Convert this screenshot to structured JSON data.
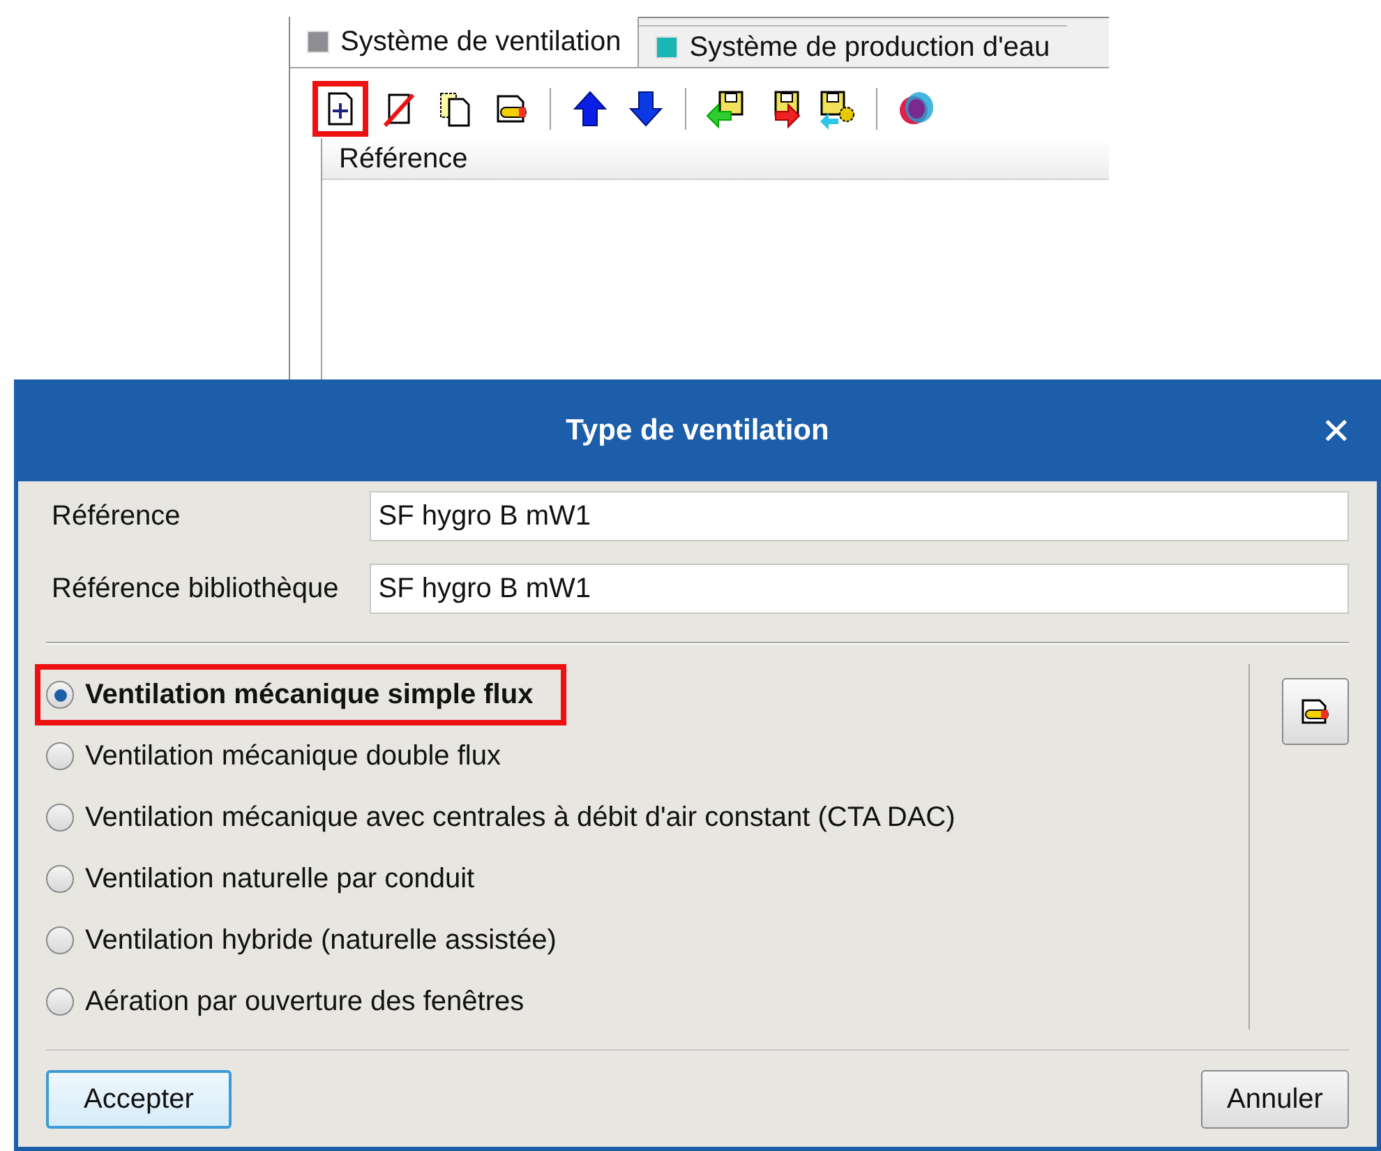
{
  "main_window": {
    "tabs": [
      {
        "label": "Système de ventilation",
        "color": "#8e8e92",
        "selected": true
      },
      {
        "label": "Système de production d'eau",
        "color": "#19b6b4",
        "selected": false
      }
    ],
    "toolbar": [
      {
        "kind": "new",
        "highlighted": true
      },
      {
        "kind": "delete",
        "highlighted": false
      },
      {
        "kind": "copy",
        "highlighted": false
      },
      {
        "kind": "edit",
        "highlighted": false
      },
      {
        "kind": "separator"
      },
      {
        "kind": "up",
        "highlighted": false
      },
      {
        "kind": "down",
        "highlighted": false
      },
      {
        "kind": "separator"
      },
      {
        "kind": "import",
        "highlighted": false
      },
      {
        "kind": "export",
        "highlighted": false
      },
      {
        "kind": "library",
        "highlighted": false
      },
      {
        "kind": "separator"
      },
      {
        "kind": "logo",
        "highlighted": false
      }
    ],
    "table": {
      "columns": [
        "Référence"
      ]
    }
  },
  "dialog": {
    "title": "Type de ventilation",
    "close": "✕",
    "fields": [
      {
        "label": "Référence",
        "value": "SF hygro B mW1"
      },
      {
        "label": "Référence bibliothèque",
        "value": "SF hygro B mW1"
      }
    ],
    "options": [
      {
        "label": "Ventilation mécanique simple flux",
        "selected": true,
        "highlighted": true
      },
      {
        "label": "Ventilation mécanique double flux",
        "selected": false,
        "highlighted": false
      },
      {
        "label": "Ventilation mécanique avec centrales à débit d'air constant (CTA DAC)",
        "selected": false,
        "highlighted": false
      },
      {
        "label": "Ventilation naturelle par conduit",
        "selected": false,
        "highlighted": false
      },
      {
        "label": "Ventilation hybride (naturelle assistée)",
        "selected": false,
        "highlighted": false
      },
      {
        "label": "Aération par ouverture des fenêtres",
        "selected": false,
        "highlighted": false
      }
    ],
    "buttons": [
      {
        "label": "Accepter",
        "default": true
      },
      {
        "label": "Annuler",
        "default": false
      }
    ]
  }
}
